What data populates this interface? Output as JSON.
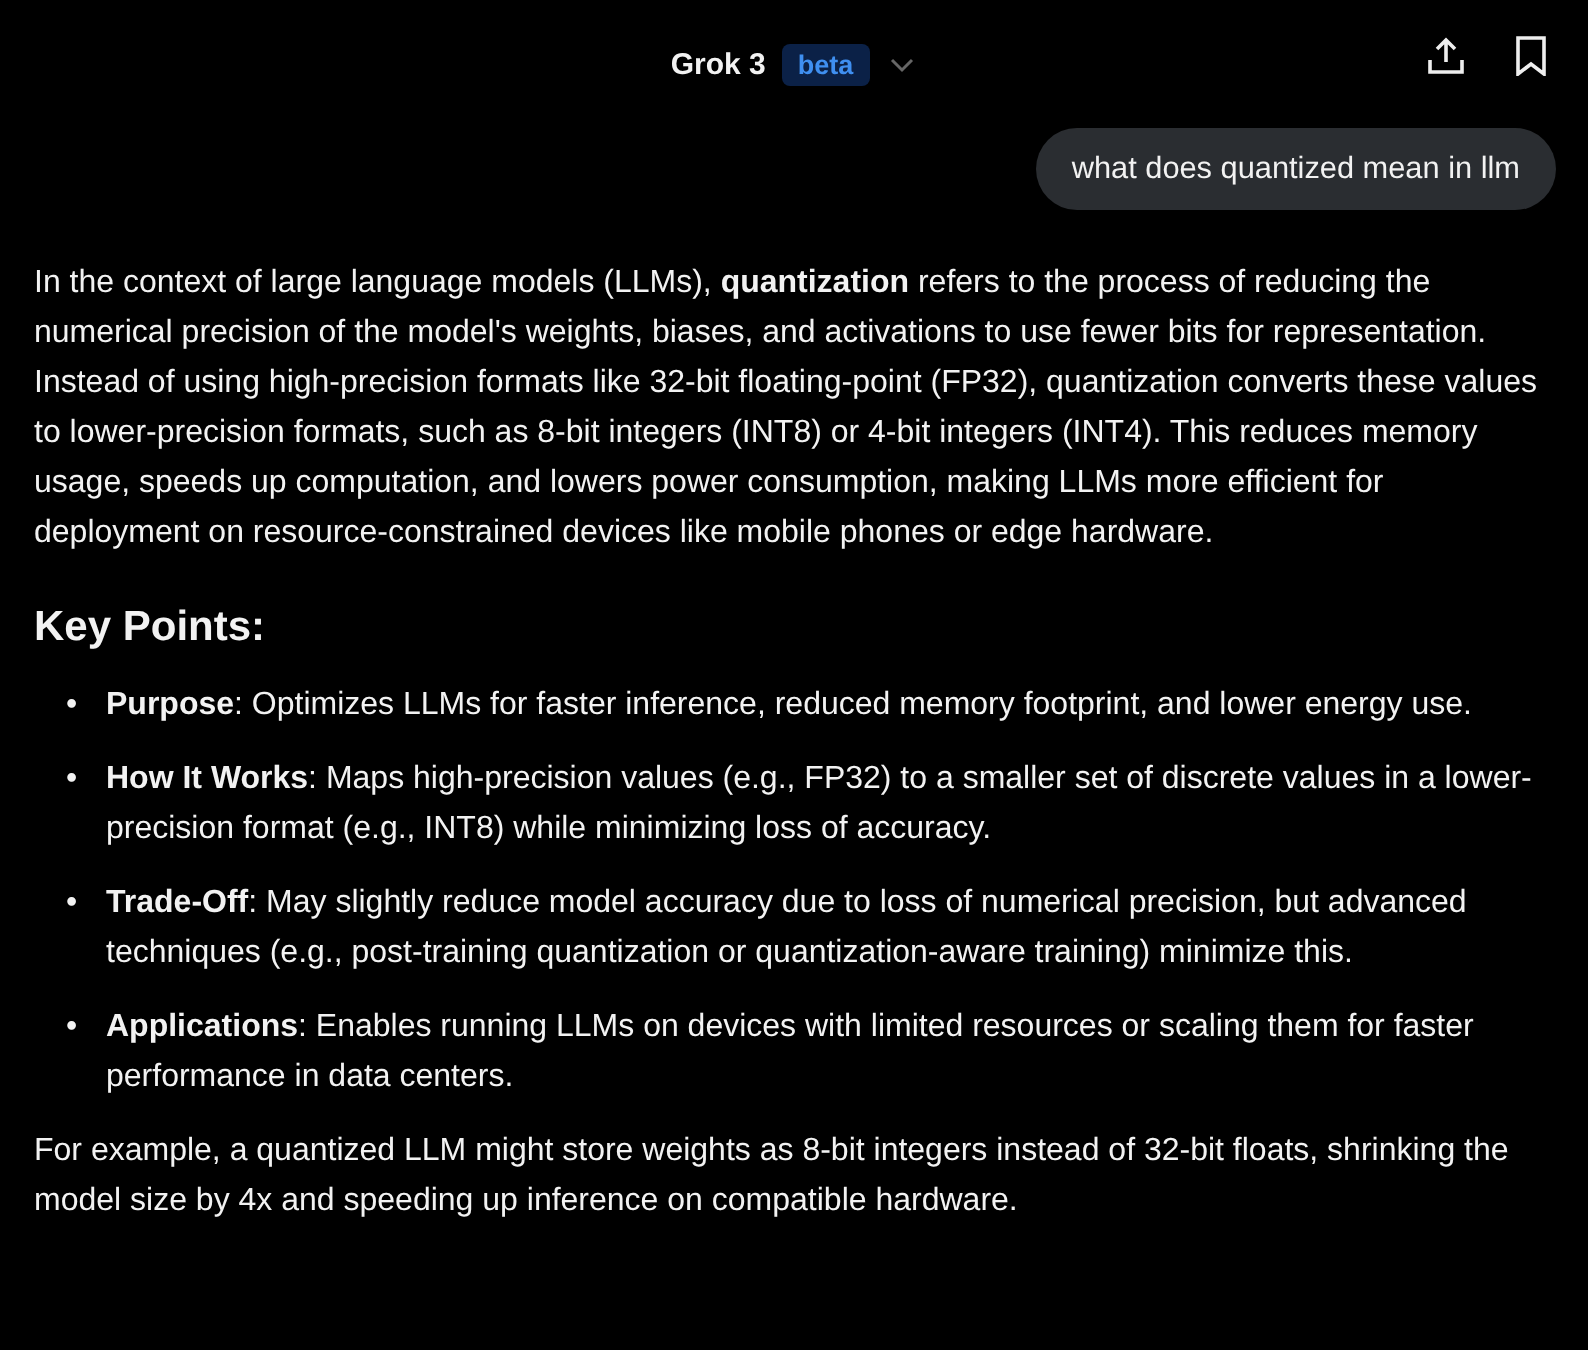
{
  "header": {
    "model": "Grok 3",
    "badge": "beta"
  },
  "user_message": "what does quantized mean in llm",
  "answer": {
    "intro": "In the context of large language models (LLMs), **quantization** refers to the process of reducing the numerical precision of the model's weights, biases, and activations to use fewer bits for representation. Instead of using high-precision formats like 32-bit floating-point (FP32), quantization converts these values to lower-precision formats, such as 8-bit integers (INT8) or 4-bit integers (INT4). This reduces memory usage, speeds up computation, and lowers power consumption, making LLMs more efficient for deployment on resource-constrained devices like mobile phones or edge hardware.",
    "heading": "Key Points:",
    "points": [
      {
        "marker": "•",
        "text": "**Purpose**: Optimizes LLMs for faster inference, reduced memory footprint, and lower energy use."
      },
      {
        "marker": "•",
        "text": "**How It Works**: Maps high-precision values (e.g., FP32) to a smaller set of discrete values in a lower-precision format (e.g., INT8) while minimizing loss of accuracy."
      },
      {
        "marker": "•",
        "text": "**Trade-Off**: May slightly reduce model accuracy due to loss of numerical precision, but advanced techniques (e.g., post-training quantization or quantization-aware training) minimize this."
      },
      {
        "marker": "•",
        "text": "**Applications**: Enables running LLMs on devices with limited resources or scaling them for faster performance in data centers."
      }
    ],
    "outro": "For example, a quantized LLM might store weights as 8-bit integers instead of 32-bit floats, shrinking the model size by 4x and speeding up inference on compatible hardware."
  }
}
